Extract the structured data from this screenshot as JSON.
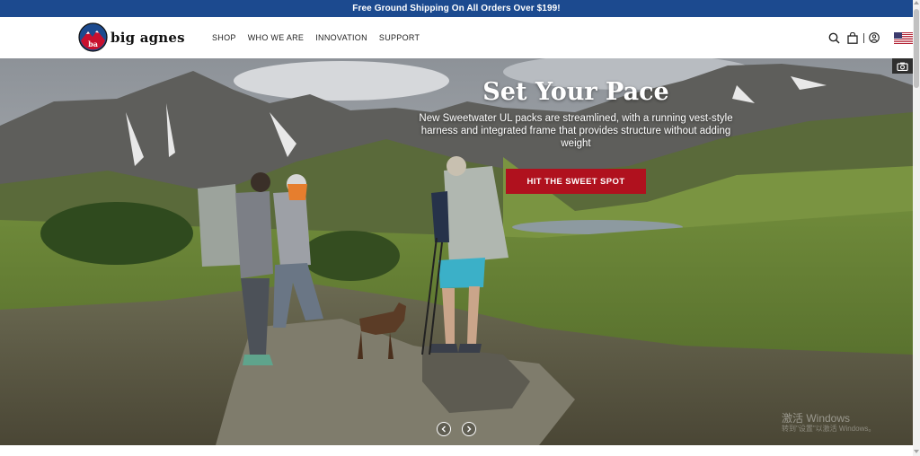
{
  "promo_bar": {
    "text": "Free Ground Shipping On All Orders Over $199!",
    "background": "#1c4a8f"
  },
  "header": {
    "logo_text": "big agnes",
    "nav": [
      {
        "label": "SHOP"
      },
      {
        "label": "WHO WE ARE"
      },
      {
        "label": "INNOVATION"
      },
      {
        "label": "SUPPORT"
      }
    ],
    "icons": [
      "search-icon",
      "cart-icon",
      "account-icon",
      "us-flag-icon"
    ]
  },
  "hero": {
    "headline": "Set Your Pace",
    "subcopy": "New Sweetwater UL packs are streamlined, with a running vest-style harness and integrated frame that provides structure without adding weight",
    "cta_label": "HIT THE SWEET SPOT",
    "cta_color": "#b0111e",
    "icons": [
      "camera-icon",
      "prev-arrow-icon",
      "next-arrow-icon"
    ]
  },
  "watermark": {
    "line1": "激活 Windows",
    "line2": "转到\"设置\"以激活 Windows。"
  }
}
